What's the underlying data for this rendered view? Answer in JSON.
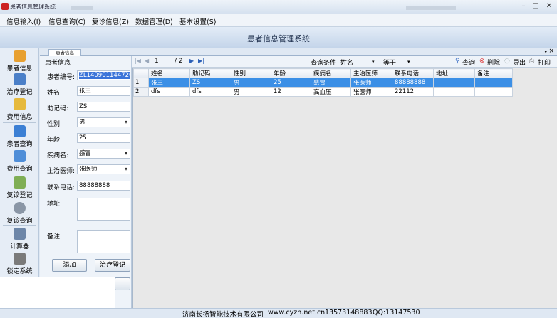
{
  "window": {
    "title": "患者信息管理系统"
  },
  "menu": [
    "信息输入(I)",
    "信息查询(C)",
    "复诊信息(Z)",
    "数据管理(D)",
    "基本设置(S)"
  ],
  "banner": {
    "title": "患者信息管理系统"
  },
  "sidebar": {
    "items": [
      {
        "label": "患者信息",
        "icon": "add-user-icon",
        "color": "#e8a030"
      },
      {
        "label": "治疗登记",
        "icon": "grid-form-icon",
        "color": "#4a7fc8"
      },
      {
        "label": "费用信息",
        "icon": "coins-icon",
        "color": "#e6b93c"
      },
      {
        "label": "患者查询",
        "icon": "user-search-icon",
        "color": "#3b7fd4"
      },
      {
        "label": "费用查询",
        "icon": "magnify-coins-icon",
        "color": "#4f8ed8"
      },
      {
        "label": "复诊登记",
        "icon": "calendar-icon",
        "color": "#7fae55"
      },
      {
        "label": "复诊查询",
        "icon": "search-icon",
        "color": "#8a96a6"
      },
      {
        "label": "计算器",
        "icon": "calculator-icon",
        "color": "#6d86a8"
      },
      {
        "label": "锁定系统",
        "icon": "lock-icon",
        "color": "#7a7a7a"
      }
    ]
  },
  "tab": {
    "label": "患者信息"
  },
  "form": {
    "title": "患者信息",
    "patient_id_label": "患者编号:",
    "patient_id_value": "ZL140901144720",
    "name_label": "姓名:",
    "name_value": "张三",
    "mnemonic_label": "助记码:",
    "mnemonic_value": "ZS",
    "gender_label": "性别:",
    "gender_value": "男",
    "age_label": "年龄:",
    "age_value": "25",
    "disease_label": "疾病名:",
    "disease_value": "感冒",
    "doctor_label": "主治医师:",
    "doctor_value": "张医师",
    "phone_label": "联系电话:",
    "phone_value": "88888888",
    "address_label": "地址:",
    "address_value": "",
    "remark_label": "备注:",
    "remark_value": "",
    "add_button": "添加",
    "treat_button": "治疗登记"
  },
  "toolbar": {
    "page_current": "1",
    "page_total": "/ 2",
    "query_condition_label": "查询条件",
    "field_value": "姓名",
    "operator_value": "等于",
    "query_button": "查询",
    "delete_button": "删除",
    "export_button": "导出",
    "print_button": "打印"
  },
  "grid": {
    "columns": [
      "姓名",
      "助记码",
      "性别",
      "年龄",
      "疾病名",
      "主治医师",
      "联系电话",
      "地址",
      "备注"
    ],
    "rows": [
      {
        "row_no": "1",
        "cells": [
          "张三",
          "ZS",
          "男",
          "25",
          "感冒",
          "张医师",
          "88888888",
          "",
          ""
        ]
      },
      {
        "row_no": "2",
        "cells": [
          "dfs",
          "dfs",
          "男",
          "12",
          "高血压",
          "张医师",
          "22112",
          "",
          ""
        ]
      }
    ]
  },
  "status": {
    "company": "济南长扬智能技术有限公司",
    "website": "www.cyzn.net.cn",
    "phone": "13573148883",
    "qq": "QQ:13147530"
  }
}
